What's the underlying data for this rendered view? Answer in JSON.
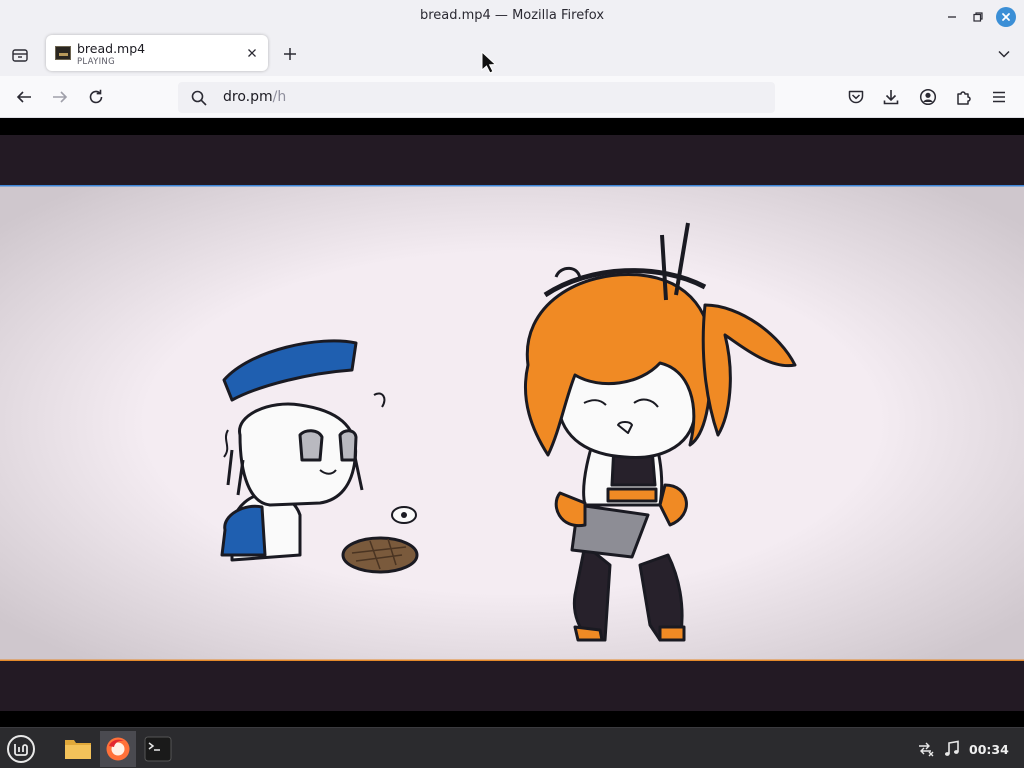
{
  "window": {
    "title": "bread.mp4 — Mozilla Firefox",
    "controls": [
      "minimize-icon",
      "restore-icon",
      "close-icon"
    ]
  },
  "tabs": [
    {
      "title": "bread.mp4",
      "status": "PLAYING",
      "active": true,
      "favicon": "video-thumbnail-icon"
    }
  ],
  "navbar": {
    "url_host": "dro.pm",
    "url_path": "/h",
    "left_icons": [
      "back-arrow-icon",
      "forward-arrow-icon",
      "reload-icon"
    ],
    "right_icons": [
      "pocket-icon",
      "download-icon",
      "account-icon",
      "extensions-icon",
      "hamburger-menu-icon"
    ]
  },
  "video": {
    "frame_background": "#f4ecf2",
    "letterbox_color": "#231a24",
    "characters": [
      "blue-beret-chibi",
      "orange-haired-chibi"
    ],
    "props": [
      "bread-loaf"
    ]
  },
  "taskbar": {
    "launchers": [
      "mint-menu-icon",
      "folder-icon",
      "firefox-icon",
      "terminal-icon"
    ],
    "tray_icons": [
      "network-disconnected-icon",
      "music-note-icon"
    ],
    "clock": "00:34"
  },
  "colors": {
    "accent": "#3b8fd6",
    "chrome_bg": "#f0f0f4",
    "taskbar_bg": "#2b2b2e"
  }
}
